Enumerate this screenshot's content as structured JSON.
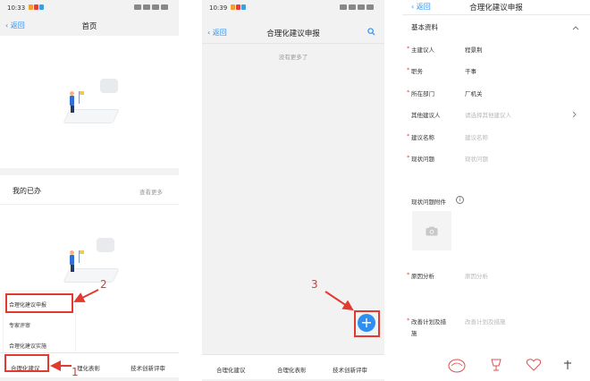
{
  "panel1": {
    "status": {
      "time": "10:33"
    },
    "nav": {
      "back": "返回",
      "title": "首页"
    },
    "todo": {
      "title": "我的已办",
      "more": "查看更多"
    },
    "popup": {
      "items": [
        "合理化建议申报",
        "专家评审",
        "合理化建议实施"
      ]
    },
    "tabs": {
      "first": "合理化建议",
      "second": "理化表彰",
      "third": "技术创新评审"
    },
    "steps": {
      "one": "1",
      "two": "2"
    }
  },
  "panel2": {
    "status": {
      "time": "10:39"
    },
    "nav": {
      "back": "返回",
      "title": "合理化建议申报"
    },
    "empty": "没有更多了",
    "add_glyph": "+",
    "tabs": [
      "合理化建议",
      "合理化表彰",
      "技术创新评审"
    ],
    "step": "3"
  },
  "panel3": {
    "nav": {
      "back": "返回",
      "title": "合理化建议申报"
    },
    "section": "基本资料",
    "fields": [
      {
        "label": "主建议人",
        "value": "程景荆",
        "required": true
      },
      {
        "label": "职务",
        "value": "干事",
        "required": true
      },
      {
        "label": "所在部门",
        "value": "厂机关",
        "required": true
      },
      {
        "label": "其他建议人",
        "placeholder": "请选择其他建议人",
        "required": false
      },
      {
        "label": "建议名称",
        "placeholder": "建议名称",
        "required": true
      },
      {
        "label": "现状问题",
        "placeholder": "现状问题",
        "required": true
      }
    ],
    "attachment": {
      "label": "现状问题附件",
      "info_glyph": "i"
    },
    "cause": {
      "label": "原因分析",
      "placeholder": "原因分析"
    },
    "plan": {
      "label_line1": "改善计划及措",
      "label_line2": "施",
      "placeholder": "改善计划及措施"
    },
    "required_mark": "*"
  },
  "colors": {
    "accent": "#2f8ff0",
    "annotation": "#e23a2e",
    "required": "#e74c3c"
  }
}
